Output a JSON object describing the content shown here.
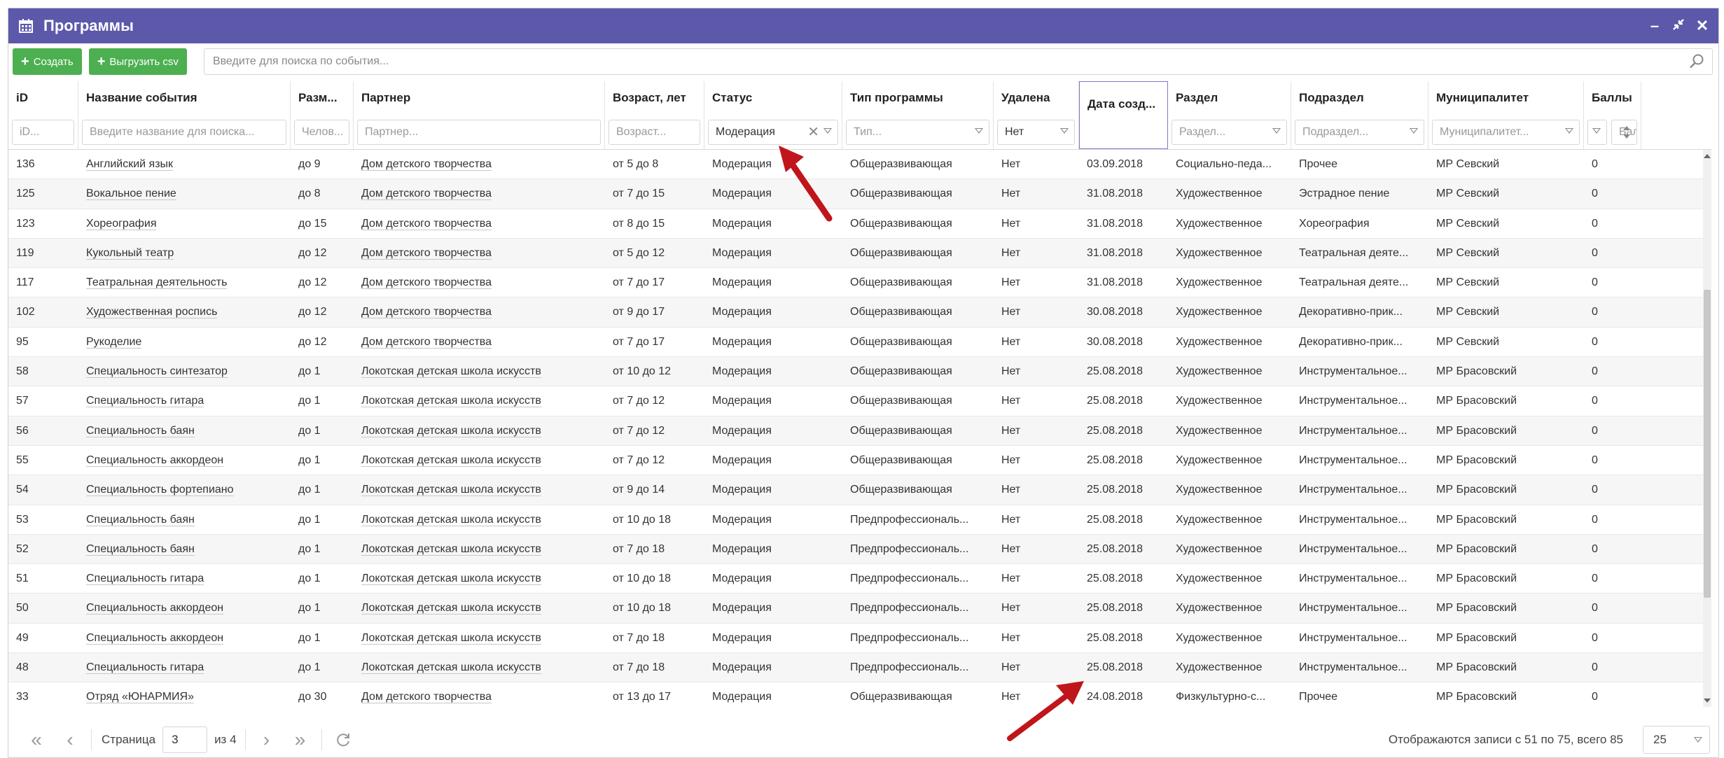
{
  "window": {
    "title": "Программы",
    "icon": "calendar-icon"
  },
  "toolbar": {
    "create_label": "Создать",
    "export_label": "Выгрузить csv",
    "search_placeholder": "Введите для поиска по события..."
  },
  "columns": [
    {
      "key": "id",
      "label": "iD",
      "filter": "iD...",
      "filter_type": "text"
    },
    {
      "key": "name",
      "label": "Название события",
      "filter": "Введите название для поиска...",
      "filter_type": "text"
    },
    {
      "key": "size",
      "label": "Разм...",
      "filter": "Челов...",
      "filter_type": "text"
    },
    {
      "key": "partner",
      "label": "Партнер",
      "filter": "Партнер...",
      "filter_type": "text"
    },
    {
      "key": "age",
      "label": "Возраст, лет",
      "filter": "Возраст...",
      "filter_type": "text"
    },
    {
      "key": "status",
      "label": "Статус",
      "filter": "Модерация",
      "filter_type": "select_value"
    },
    {
      "key": "type",
      "label": "Тип программы",
      "filter": "Тип...",
      "filter_type": "select"
    },
    {
      "key": "deleted",
      "label": "Удалена",
      "filter": "Нет",
      "filter_type": "select_value"
    },
    {
      "key": "date",
      "label": "Дата созд...",
      "filter": "",
      "filter_type": "none"
    },
    {
      "key": "section",
      "label": "Раздел",
      "filter": "Раздел...",
      "filter_type": "select"
    },
    {
      "key": "subsection",
      "label": "Подраздел",
      "filter": "Подраздел...",
      "filter_type": "select"
    },
    {
      "key": "municipality",
      "label": "Муниципалитет",
      "filter": "Муниципалитет...",
      "filter_type": "select"
    },
    {
      "key": "score",
      "label": "Баллы",
      "filter": "Балл",
      "filter_type": "score"
    }
  ],
  "rows": [
    {
      "id": "136",
      "name": "Английский язык",
      "size": "до 9",
      "partner": "Дом детского творчества",
      "age": "от 5 до 8",
      "status": "Модерация",
      "type": "Общеразвивающая",
      "deleted": "Нет",
      "date": "03.09.2018",
      "section": "Социально-педа...",
      "subsection": "Прочее",
      "municipality": "МР Севский",
      "score": "0"
    },
    {
      "id": "125",
      "name": "Вокальное пение",
      "size": "до 8",
      "partner": "Дом детского творчества",
      "age": "от 7 до 15",
      "status": "Модерация",
      "type": "Общеразвивающая",
      "deleted": "Нет",
      "date": "31.08.2018",
      "section": "Художественное",
      "subsection": "Эстрадное пение",
      "municipality": "МР Севский",
      "score": "0"
    },
    {
      "id": "123",
      "name": "Хореография",
      "size": "до 15",
      "partner": "Дом детского творчества",
      "age": "от 8 до 15",
      "status": "Модерация",
      "type": "Общеразвивающая",
      "deleted": "Нет",
      "date": "31.08.2018",
      "section": "Художественное",
      "subsection": "Хореография",
      "municipality": "МР Севский",
      "score": "0"
    },
    {
      "id": "119",
      "name": "Кукольный театр",
      "size": "до 12",
      "partner": "Дом детского творчества",
      "age": "от 5 до 12",
      "status": "Модерация",
      "type": "Общеразвивающая",
      "deleted": "Нет",
      "date": "31.08.2018",
      "section": "Художественное",
      "subsection": "Театральная деяте...",
      "municipality": "МР Севский",
      "score": "0"
    },
    {
      "id": "117",
      "name": "Театральная деятельность",
      "size": "до 12",
      "partner": "Дом детского творчества",
      "age": "от 7 до 17",
      "status": "Модерация",
      "type": "Общеразвивающая",
      "deleted": "Нет",
      "date": "31.08.2018",
      "section": "Художественное",
      "subsection": "Театральная деяте...",
      "municipality": "МР Севский",
      "score": "0"
    },
    {
      "id": "102",
      "name": "Художественная роспись",
      "size": "до 12",
      "partner": "Дом детского творчества",
      "age": "от 9 до 17",
      "status": "Модерация",
      "type": "Общеразвивающая",
      "deleted": "Нет",
      "date": "30.08.2018",
      "section": "Художественное",
      "subsection": "Декоративно-прик...",
      "municipality": "МР Севский",
      "score": "0"
    },
    {
      "id": "95",
      "name": "Рукоделие",
      "size": "до 12",
      "partner": "Дом детского творчества",
      "age": "от 7 до 17",
      "status": "Модерация",
      "type": "Общеразвивающая",
      "deleted": "Нет",
      "date": "30.08.2018",
      "section": "Художественное",
      "subsection": "Декоративно-прик...",
      "municipality": "МР Севский",
      "score": "0"
    },
    {
      "id": "58",
      "name": "Специальность синтезатор",
      "size": "до 1",
      "partner": "Локотская детская школа искусств",
      "age": "от 10 до 12",
      "status": "Модерация",
      "type": "Общеразвивающая",
      "deleted": "Нет",
      "date": "25.08.2018",
      "section": "Художественное",
      "subsection": "Инструментальное...",
      "municipality": "МР Брасовский",
      "score": "0"
    },
    {
      "id": "57",
      "name": "Специальность гитара",
      "size": "до 1",
      "partner": "Локотская детская школа искусств",
      "age": "от 7 до 12",
      "status": "Модерация",
      "type": "Общеразвивающая",
      "deleted": "Нет",
      "date": "25.08.2018",
      "section": "Художественное",
      "subsection": "Инструментальное...",
      "municipality": "МР Брасовский",
      "score": "0"
    },
    {
      "id": "56",
      "name": "Специальность баян",
      "size": "до 1",
      "partner": "Локотская детская школа искусств",
      "age": "от 7 до 12",
      "status": "Модерация",
      "type": "Общеразвивающая",
      "deleted": "Нет",
      "date": "25.08.2018",
      "section": "Художественное",
      "subsection": "Инструментальное...",
      "municipality": "МР Брасовский",
      "score": "0"
    },
    {
      "id": "55",
      "name": "Специальность аккордеон",
      "size": "до 1",
      "partner": "Локотская детская школа искусств",
      "age": "от 7 до 12",
      "status": "Модерация",
      "type": "Общеразвивающая",
      "deleted": "Нет",
      "date": "25.08.2018",
      "section": "Художественное",
      "subsection": "Инструментальное...",
      "municipality": "МР Брасовский",
      "score": "0"
    },
    {
      "id": "54",
      "name": "Специальность фортепиано",
      "size": "до 1",
      "partner": "Локотская детская школа искусств",
      "age": "от 9 до 14",
      "status": "Модерация",
      "type": "Общеразвивающая",
      "deleted": "Нет",
      "date": "25.08.2018",
      "section": "Художественное",
      "subsection": "Инструментальное...",
      "municipality": "МР Брасовский",
      "score": "0"
    },
    {
      "id": "53",
      "name": "Специальность баян",
      "size": "до 1",
      "partner": "Локотская детская школа искусств",
      "age": "от 10 до 18",
      "status": "Модерация",
      "type": "Предпрофессиональ...",
      "deleted": "Нет",
      "date": "25.08.2018",
      "section": "Художественное",
      "subsection": "Инструментальное...",
      "municipality": "МР Брасовский",
      "score": "0"
    },
    {
      "id": "52",
      "name": "Специальность баян",
      "size": "до 1",
      "partner": "Локотская детская школа искусств",
      "age": "от 7 до 18",
      "status": "Модерация",
      "type": "Предпрофессиональ...",
      "deleted": "Нет",
      "date": "25.08.2018",
      "section": "Художественное",
      "subsection": "Инструментальное...",
      "municipality": "МР Брасовский",
      "score": "0"
    },
    {
      "id": "51",
      "name": "Специальность гитара",
      "size": "до 1",
      "partner": "Локотская детская школа искусств",
      "age": "от 10 до 18",
      "status": "Модерация",
      "type": "Предпрофессиональ...",
      "deleted": "Нет",
      "date": "25.08.2018",
      "section": "Художественное",
      "subsection": "Инструментальное...",
      "municipality": "МР Брасовский",
      "score": "0"
    },
    {
      "id": "50",
      "name": "Специальность аккордеон",
      "size": "до 1",
      "partner": "Локотская детская школа искусств",
      "age": "от 10 до 18",
      "status": "Модерация",
      "type": "Предпрофессиональ...",
      "deleted": "Нет",
      "date": "25.08.2018",
      "section": "Художественное",
      "subsection": "Инструментальное...",
      "municipality": "МР Брасовский",
      "score": "0"
    },
    {
      "id": "49",
      "name": "Специальность аккордеон",
      "size": "до 1",
      "partner": "Локотская детская школа искусств",
      "age": "от 7 до 18",
      "status": "Модерация",
      "type": "Предпрофессиональ...",
      "deleted": "Нет",
      "date": "25.08.2018",
      "section": "Художественное",
      "subsection": "Инструментальное...",
      "municipality": "МР Брасовский",
      "score": "0"
    },
    {
      "id": "48",
      "name": "Специальность гитара",
      "size": "до 1",
      "partner": "Локотская детская школа искусств",
      "age": "от 7 до 18",
      "status": "Модерация",
      "type": "Предпрофессиональ...",
      "deleted": "Нет",
      "date": "25.08.2018",
      "section": "Художественное",
      "subsection": "Инструментальное...",
      "municipality": "МР Брасовский",
      "score": "0"
    },
    {
      "id": "33",
      "name": "Отряд «ЮНАРМИЯ»",
      "size": "до 30",
      "partner": "Дом детского творчества",
      "age": "от 13 до 17",
      "status": "Модерация",
      "type": "Общеразвивающая",
      "deleted": "Нет",
      "date": "24.08.2018",
      "section": "Физкультурно-с...",
      "subsection": "Прочее",
      "municipality": "МР Брасовский",
      "score": "0"
    }
  ],
  "pager": {
    "page_label": "Страница",
    "page_value": "3",
    "of_label": "из 4",
    "info": "Отображаются записи с 51 по 75, всего 85",
    "page_size": "25"
  },
  "colors": {
    "titlebar": "#5c59ab",
    "button": "#4caf50",
    "annotation_arrow": "#c0151b"
  }
}
